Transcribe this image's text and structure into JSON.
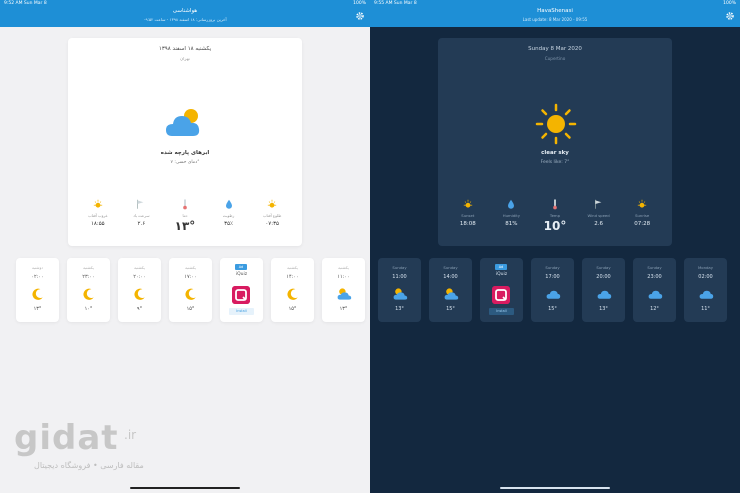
{
  "light": {
    "status": {
      "time": "9:52 AM  Sun Mar 8",
      "battery": "100%"
    },
    "header": {
      "title": "هواشناسی",
      "subtitle": "آخرین بروزرسانی: ۱۸ اسفند ۱۳۹۸ - ساعت ۰۹:۵۲"
    },
    "main": {
      "date": "یکشنبه ۱۸ اسفند ۱۳۹۸",
      "location": "تهران",
      "condition": "ابرهای پارچه شده",
      "feels_like": "دمای حسی: ۷°",
      "stats": [
        {
          "label": "غروب آفتاب",
          "value": "۱۸:۵۵",
          "icon": "sunset-icon"
        },
        {
          "label": "سرعت باد",
          "value": "۲.۶",
          "icon": "wind-icon"
        },
        {
          "label": "دما",
          "value": "۱۳°",
          "icon": "thermometer-icon",
          "big": true
        },
        {
          "label": "رطوبت",
          "value": "۳۵٪",
          "icon": "humidity-icon"
        },
        {
          "label": "طلوع آفتاب",
          "value": "۰۷:۳۵",
          "icon": "sunrise-icon"
        }
      ]
    },
    "hourly": [
      {
        "day": "یکشنبه",
        "time": "۱۱:۰۰",
        "temp": "۱۳°",
        "icon": "cloud-sun-icon"
      },
      {
        "day": "یکشنبه",
        "time": "۱۴:۰۰",
        "temp": "۱۵°",
        "icon": "moon-icon"
      },
      {
        "ad": true,
        "badge": "Ad",
        "name": "iQuiz",
        "button": "Install"
      },
      {
        "day": "یکشنبه",
        "time": "۱۷:۰۰",
        "temp": "۱۵°",
        "icon": "moon-icon"
      },
      {
        "day": "یکشنبه",
        "time": "۲۰:۰۰",
        "temp": "۹°",
        "icon": "moon-icon"
      },
      {
        "day": "یکشنبه",
        "time": "۲۳:۰۰",
        "temp": "۱۰°",
        "icon": "moon-icon"
      },
      {
        "day": "دوشنبه",
        "time": "۰۲:۰۰",
        "temp": "۱۳°",
        "icon": "moon-icon"
      }
    ]
  },
  "dark": {
    "status": {
      "time": "9:55 AM  Sun Mar 8",
      "battery": "100%"
    },
    "header": {
      "title": "HavaShenasi",
      "subtitle": "Last update: 8 Mar 2020 - 09:55"
    },
    "main": {
      "date": "Sunday 8 Mar 2020",
      "location": "Cupertino",
      "condition": "clear sky",
      "feels_like": "Feels like: 7°",
      "stats": [
        {
          "label": "Sunset",
          "value": "18:08",
          "icon": "sunset-icon"
        },
        {
          "label": "Humidity",
          "value": "81%",
          "icon": "humidity-icon"
        },
        {
          "label": "Temp",
          "value": "10°",
          "icon": "thermometer-icon",
          "big": true
        },
        {
          "label": "Wind speed",
          "value": "2.6",
          "icon": "wind-icon"
        },
        {
          "label": "Sunrise",
          "value": "07:28",
          "icon": "sunrise-icon"
        }
      ]
    },
    "hourly": [
      {
        "day": "Sunday",
        "time": "11:00",
        "temp": "13°",
        "icon": "cloud-sun-icon"
      },
      {
        "day": "Sunday",
        "time": "14:00",
        "temp": "15°",
        "icon": "cloud-sun-icon"
      },
      {
        "ad": true,
        "badge": "Ad",
        "name": "iQuiz",
        "button": "Install"
      },
      {
        "day": "Sunday",
        "time": "17:00",
        "temp": "15°",
        "icon": "cloud-icon"
      },
      {
        "day": "Sunday",
        "time": "20:00",
        "temp": "13°",
        "icon": "cloud-icon"
      },
      {
        "day": "Sunday",
        "time": "23:00",
        "temp": "12°",
        "icon": "cloud-icon"
      },
      {
        "day": "Monday",
        "time": "02:00",
        "temp": "11°",
        "icon": "cloud-icon"
      }
    ]
  },
  "watermark": {
    "logo": "gidat",
    "tld": ".ir",
    "tagline": "مقاله فارسی • فروشگاه دیجیتال"
  },
  "colors": {
    "header": "#1e8fd6",
    "dark_bg": "#13283f",
    "dark_card": "#233b55",
    "sun": "#f4b400",
    "cloud": "#4aa3e8"
  }
}
